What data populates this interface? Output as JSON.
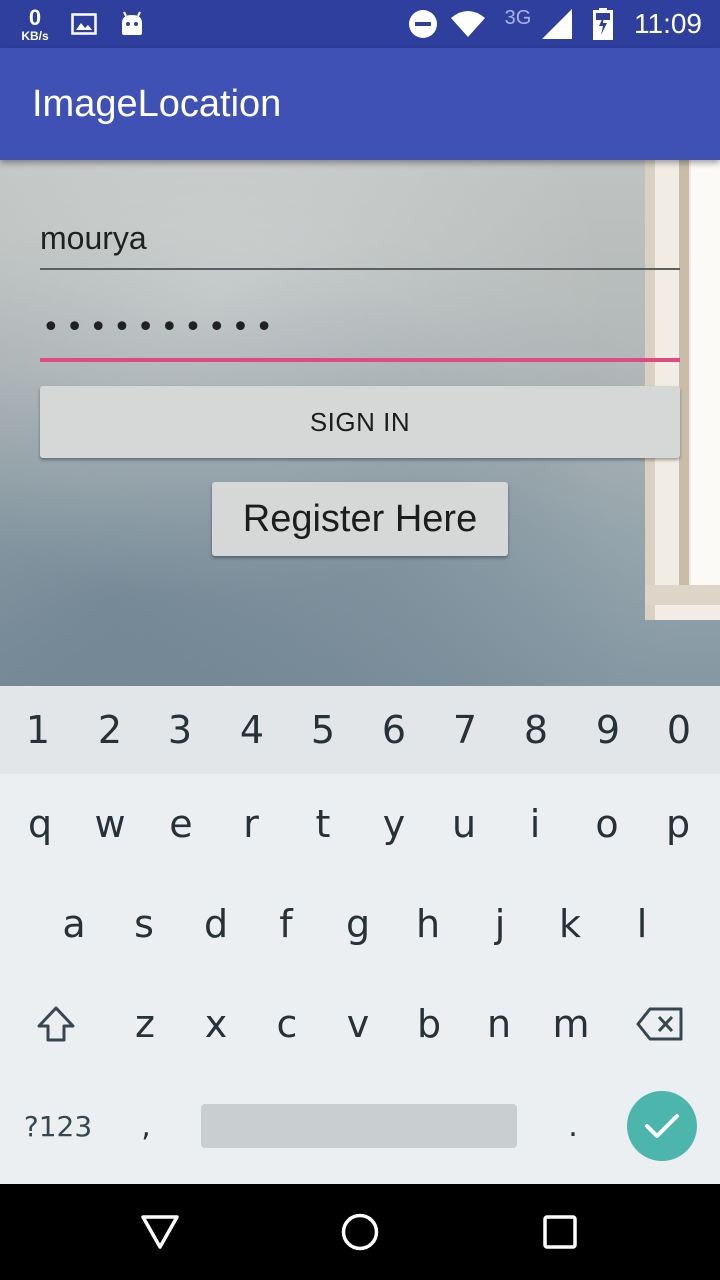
{
  "status_bar": {
    "kbs_value": "0",
    "kbs_unit": "KB/s",
    "network": "3G",
    "time": "11:09",
    "icons": [
      "image-icon",
      "android-icon",
      "do-not-disturb-icon",
      "wifi-icon",
      "signal-icon",
      "battery-charging-icon"
    ]
  },
  "app_bar": {
    "title": "ImageLocation"
  },
  "form": {
    "username": "mourya",
    "password_mask": "••••••••••",
    "accent_color": "#e04a80",
    "sign_in_label": "SIGN IN",
    "register_label": "Register Here"
  },
  "keyboard": {
    "number_row": [
      "1",
      "2",
      "3",
      "4",
      "5",
      "6",
      "7",
      "8",
      "9",
      "0"
    ],
    "row1": [
      "q",
      "w",
      "e",
      "r",
      "t",
      "y",
      "u",
      "i",
      "o",
      "p"
    ],
    "row2": [
      "a",
      "s",
      "d",
      "f",
      "g",
      "h",
      "j",
      "k",
      "l"
    ],
    "row3": [
      "z",
      "x",
      "c",
      "v",
      "b",
      "n",
      "m"
    ],
    "symbols_label": "?123",
    "comma": ",",
    "period": ".",
    "done_color": "#4db6ac"
  },
  "nav_bar": {
    "icons": [
      "back-icon",
      "home-icon",
      "recents-icon"
    ]
  }
}
